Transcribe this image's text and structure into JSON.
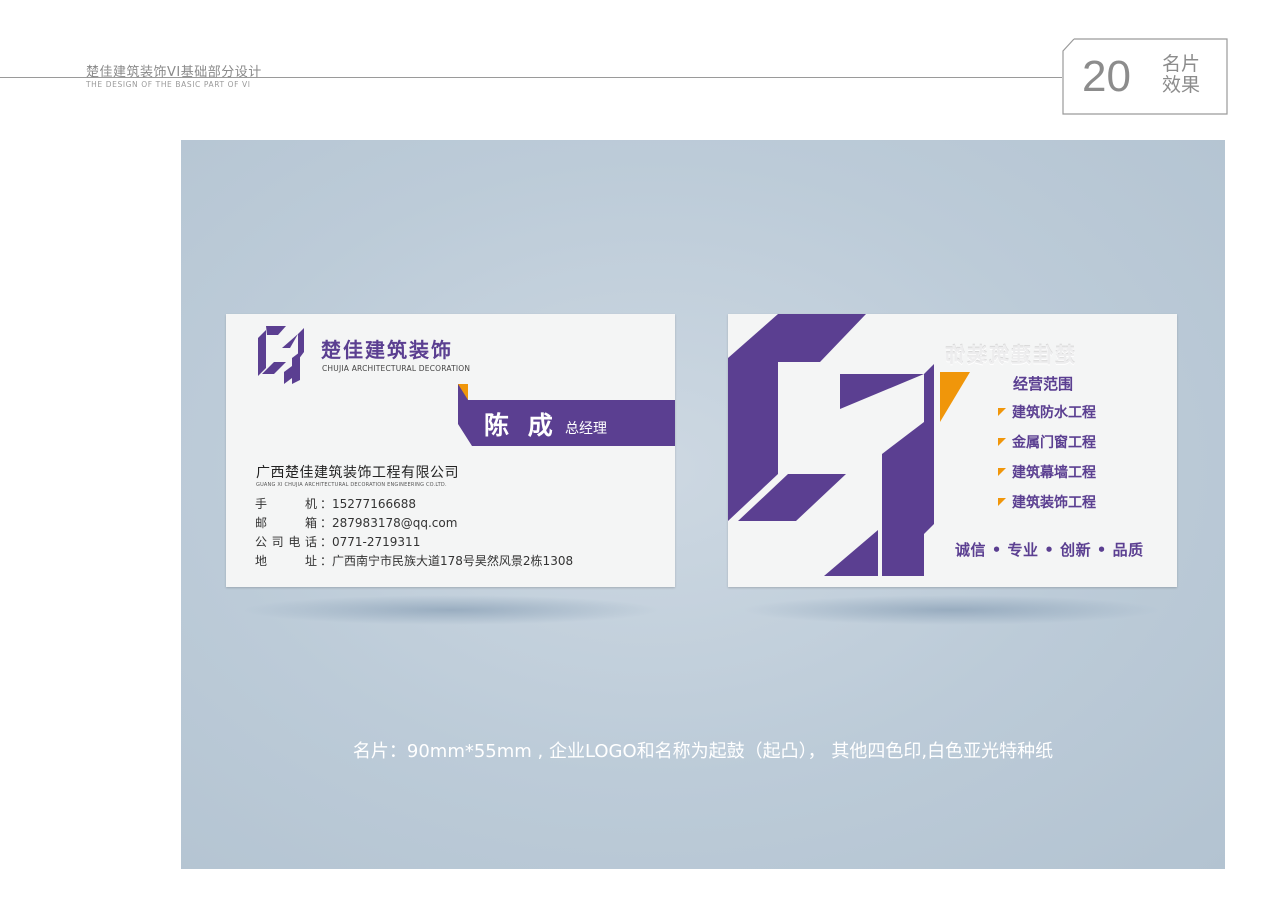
{
  "header": {
    "title": "楚佳建筑装饰VI基础部分设计",
    "subtitle": "THE DESIGN OF THE BASIC PART OF VI",
    "page_number": "20",
    "section_label_line1": "名片",
    "section_label_line2": "效果"
  },
  "front_card": {
    "brand_name": "楚佳建筑装饰",
    "brand_name_en": "CHUJIA ARCHITECTURAL DECORATION",
    "person_name": "陈 成",
    "person_title": "总经理",
    "company": "广西楚佳建筑装饰工程有限公司",
    "company_en": "GUANG XI CHUJIA ARCHITECTURAL DECORATION ENGINEERING CO.LTD.",
    "contacts": [
      {
        "label": "手机",
        "value": "15277166688"
      },
      {
        "label": "邮箱",
        "value": "287983178@qq.com"
      },
      {
        "label": "公司电话",
        "value": "0771-2719311"
      },
      {
        "label": "地址",
        "value": "广西南宁市民族大道178号昊然风景2栋1308"
      }
    ]
  },
  "back_card": {
    "embossed_brand": "楚佳建筑装饰",
    "scope_title": "经营范围",
    "scope_items": [
      "建筑防水工程",
      "金属门窗工程",
      "建筑幕墙工程",
      "建筑装饰工程"
    ],
    "values_line": "诚信 • 专业 • 创新 • 品质"
  },
  "caption": "名片：90mm*55mm , 企业LOGO和名称为起鼓（起凸），  其他四色印,白色亚光特种纸",
  "colors": {
    "brand_purple": "#5b3f91",
    "accent_orange": "#f0960a",
    "panel_blue": "#bccbd8"
  }
}
